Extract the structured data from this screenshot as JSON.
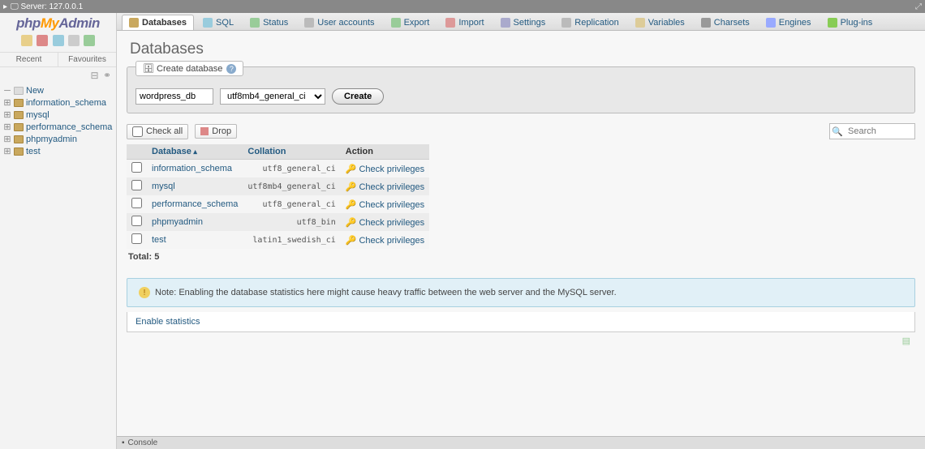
{
  "server": {
    "label": "Server",
    "host": "127.0.0.1"
  },
  "logo": {
    "p1": "php",
    "p2": "My",
    "p3": "Admin"
  },
  "sidebar": {
    "recent": "Recent",
    "favourites": "Favourites",
    "new": "New",
    "items": [
      {
        "label": "information_schema"
      },
      {
        "label": "mysql"
      },
      {
        "label": "performance_schema"
      },
      {
        "label": "phpmyadmin"
      },
      {
        "label": "test"
      }
    ]
  },
  "tabs": [
    {
      "label": "Databases",
      "icon": "tc-db",
      "active": true
    },
    {
      "label": "SQL",
      "icon": "tc-sql"
    },
    {
      "label": "Status",
      "icon": "tc-status"
    },
    {
      "label": "User accounts",
      "icon": "tc-users"
    },
    {
      "label": "Export",
      "icon": "tc-export"
    },
    {
      "label": "Import",
      "icon": "tc-import"
    },
    {
      "label": "Settings",
      "icon": "tc-settings"
    },
    {
      "label": "Replication",
      "icon": "tc-rep"
    },
    {
      "label": "Variables",
      "icon": "tc-var"
    },
    {
      "label": "Charsets",
      "icon": "tc-char"
    },
    {
      "label": "Engines",
      "icon": "tc-eng"
    },
    {
      "label": "Plug-ins",
      "icon": "tc-plug"
    }
  ],
  "page": {
    "title": "Databases",
    "create_legend": "Create database",
    "dbname_value": "wordpress_db",
    "collation_value": "utf8mb4_general_ci",
    "create_btn": "Create",
    "check_all": "Check all",
    "drop": "Drop",
    "search_placeholder": "Search",
    "cols": {
      "database": "Database",
      "collation": "Collation",
      "action": "Action"
    },
    "rows": [
      {
        "db": "information_schema",
        "coll": "utf8_general_ci",
        "action": "Check privileges"
      },
      {
        "db": "mysql",
        "coll": "utf8mb4_general_ci",
        "action": "Check privileges"
      },
      {
        "db": "performance_schema",
        "coll": "utf8_general_ci",
        "action": "Check privileges"
      },
      {
        "db": "phpmyadmin",
        "coll": "utf8_bin",
        "action": "Check privileges"
      },
      {
        "db": "test",
        "coll": "latin1_swedish_ci",
        "action": "Check privileges"
      }
    ],
    "total_label": "Total:",
    "total_value": "5",
    "notice": "Note: Enabling the database statistics here might cause heavy traffic between the web server and the MySQL server.",
    "enable_stats": "Enable statistics"
  },
  "console": "Console"
}
